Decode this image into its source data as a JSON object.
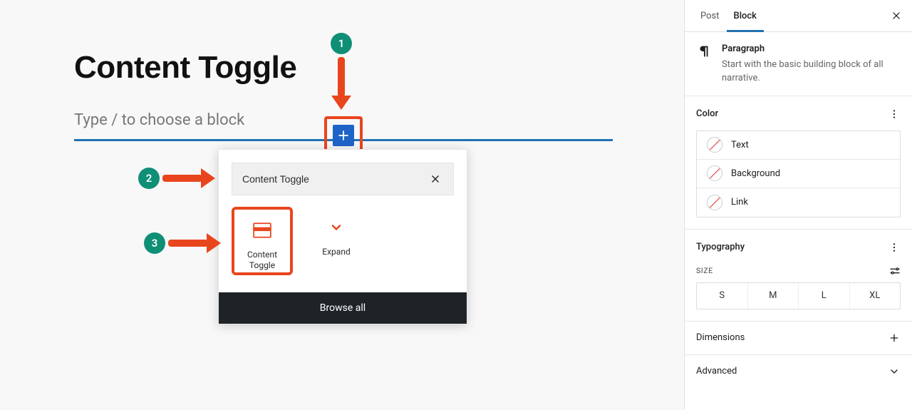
{
  "editor": {
    "title": "Content Toggle",
    "paragraph_placeholder": "Type / to choose a block"
  },
  "inserter": {
    "search_value": "Content Toggle",
    "browse_all": "Browse all",
    "blocks": [
      {
        "label": "Content Toggle"
      },
      {
        "label": "Expand"
      }
    ]
  },
  "annotations": {
    "step1": "1",
    "step2": "2",
    "step3": "3"
  },
  "sidebar": {
    "tabs": {
      "post": "Post",
      "block": "Block"
    },
    "block_meta": {
      "name": "Paragraph",
      "desc": "Start with the basic building block of all narrative."
    },
    "panels": {
      "color": {
        "title": "Color",
        "rows": {
          "text": "Text",
          "background": "Background",
          "link": "Link"
        }
      },
      "typography": {
        "title": "Typography",
        "size_label": "SIZE",
        "sizes": [
          "S",
          "M",
          "L",
          "XL"
        ]
      },
      "dimensions": "Dimensions",
      "advanced": "Advanced"
    }
  },
  "colors": {
    "accent_red": "#e9451d",
    "badge_teal": "#0f8f76",
    "wp_blue": "#2271b1"
  }
}
